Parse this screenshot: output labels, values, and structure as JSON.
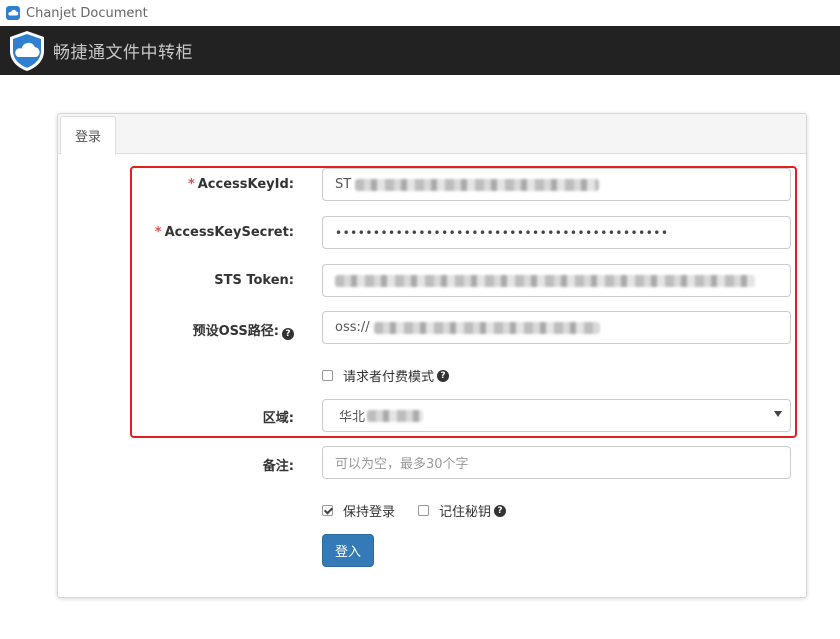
{
  "window": {
    "title": "Chanjet Document"
  },
  "navbar": {
    "brand": "畅捷通文件中转柜"
  },
  "tabs": [
    {
      "label": "登录",
      "active": true
    }
  ],
  "form": {
    "access_key_id": {
      "label": "AccessKeyId:",
      "required_mark": "*",
      "value": "ST"
    },
    "access_key_secret": {
      "label": "AccessKeySecret:",
      "required_mark": "*",
      "value": "••••••••••••••••••••••••••••••••••••••••••••"
    },
    "sts_token": {
      "label": "STS Token:",
      "value": ""
    },
    "oss_path": {
      "label": "预设OSS路径:",
      "value": "oss://"
    },
    "requester_pays": {
      "label": "请求者付费模式",
      "checked": false
    },
    "region": {
      "label": "区域:",
      "value": "华北"
    },
    "remark": {
      "label": "备注:",
      "placeholder": "可以为空，最多30个字"
    },
    "keep_login": {
      "label": "保持登录",
      "checked": true
    },
    "remember_secret": {
      "label": "记住秘钥",
      "checked": false
    },
    "submit_label": "登入"
  },
  "icons": {
    "help": "question-circle-icon",
    "logo": "cloud-shield-icon"
  },
  "colors": {
    "primary": "#337ab7",
    "navbar": "#222222",
    "highlight": "#e02020",
    "required": "#d9534f"
  }
}
